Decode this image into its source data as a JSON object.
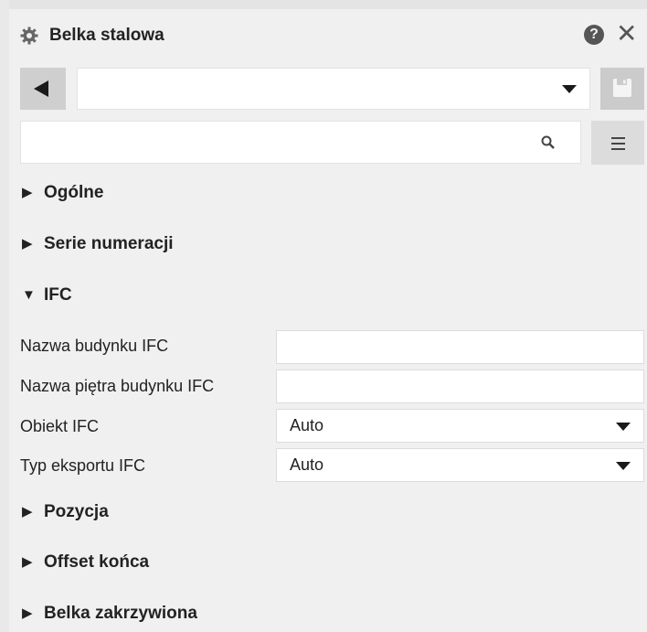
{
  "window": {
    "title": "Belka stalowa",
    "icons": {
      "settings": "gear-icon",
      "help": "help-icon",
      "close": "close-icon"
    },
    "help_glyph": "?",
    "close_glyph": "✕"
  },
  "toolbar": {
    "preset_value": "",
    "search_value": "",
    "search_placeholder": ""
  },
  "sections": {
    "general": {
      "label": "Ogólne",
      "arrow": "▶"
    },
    "numbering": {
      "label": "Serie numeracji",
      "arrow": "▶"
    },
    "ifc": {
      "label": "IFC",
      "arrow": "▼"
    },
    "position": {
      "label": "Pozycja",
      "arrow": "▶"
    },
    "end_offset": {
      "label": "Offset końca",
      "arrow": "▶"
    },
    "curved_beam": {
      "label": "Belka zakrzywiona",
      "arrow": "▶"
    }
  },
  "ifc_properties": {
    "building_name": {
      "label": "Nazwa budynku IFC",
      "value": ""
    },
    "storey_name": {
      "label": "Nazwa piętra budynku IFC",
      "value": ""
    },
    "entity": {
      "label": "Obiekt IFC",
      "value": "Auto"
    },
    "export_type": {
      "label": "Typ eksportu IFC",
      "value": "Auto"
    }
  },
  "colors": {
    "background": "#f0f0f0",
    "button_gray": "#cfcfcf",
    "text": "#222222"
  }
}
